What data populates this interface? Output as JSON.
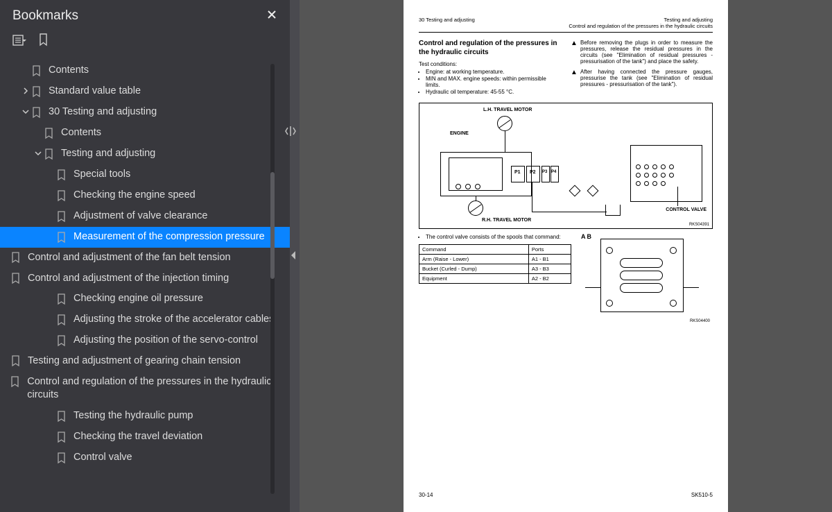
{
  "sidebar": {
    "title": "Bookmarks",
    "tree": [
      {
        "lvl": 1,
        "chev": "",
        "label": "Contents"
      },
      {
        "lvl": 1,
        "chev": ">",
        "label": "Standard value table"
      },
      {
        "lvl": 1,
        "chev": "v",
        "label": "30 Testing and adjusting"
      },
      {
        "lvl": 2,
        "chev": "",
        "label": "Contents"
      },
      {
        "lvl": 2,
        "chev": "v",
        "label": "Testing and adjusting"
      },
      {
        "lvl": 3,
        "chev": "",
        "label": "Special tools"
      },
      {
        "lvl": 3,
        "chev": "",
        "label": "Checking the engine speed"
      },
      {
        "lvl": 3,
        "chev": "",
        "label": "Adjustment of valve clearance"
      },
      {
        "lvl": 3,
        "chev": "",
        "label": "Measurement of the compression pressure",
        "sel": true
      },
      {
        "lvl": 3,
        "chev": "",
        "label": "Control and adjustment of the fan belt tension",
        "tall": true
      },
      {
        "lvl": 3,
        "chev": "",
        "label": "Control and adjustment of the injection timing",
        "tall": true
      },
      {
        "lvl": 3,
        "chev": "",
        "label": "Checking engine oil pressure"
      },
      {
        "lvl": 3,
        "chev": "",
        "label": "Adjusting the stroke of the accelerator cables"
      },
      {
        "lvl": 3,
        "chev": "",
        "label": "Adjusting the position of the servo-control"
      },
      {
        "lvl": 3,
        "chev": "",
        "label": "Testing and adjustment of gearing chain tension",
        "tall": true
      },
      {
        "lvl": 3,
        "chev": "",
        "label": "Control and regulation of the pressures in the hydraulic circuits",
        "tall": true
      },
      {
        "lvl": 3,
        "chev": "",
        "label": "Testing the hydraulic pump"
      },
      {
        "lvl": 3,
        "chev": "",
        "label": "Checking the travel deviation"
      },
      {
        "lvl": 3,
        "chev": "",
        "label": "Control valve"
      }
    ]
  },
  "page": {
    "hdr_l": "30 Testing and adjusting",
    "hdr_r1": "Testing and adjusting",
    "hdr_r2": "Control and regulation of the pressures in the hydraulic circuits",
    "title": "Control and regulation of the pressures in the hydraulic circuits",
    "tc_label": "Test conditions:",
    "tc": [
      "Engine: at working temperature.",
      "MIN and MAX. engine speeds: within permissible limits.",
      "Hydraulic oil temperature: 45-55 °C."
    ],
    "warn1": "Before removing the plugs in order to measure the pressures, release the residual pressures in the circuits (see \"Elimination of residual pressures - pressurisation of the tank\") and place the safety.",
    "warn2": "After having connected the pressure gauges, pressurise the tank (see \"Elimination of residual pressures - pressurisation of the tank\").",
    "diag": {
      "lh": "L.H. TRAVEL MOTOR",
      "rh": "R.H. TRAVEL MOTOR",
      "eng": "ENGINE",
      "cv": "CONTROL VALVE",
      "p1": "P1",
      "p2": "P2",
      "p3": "P3",
      "p4": "P4",
      "ref": "RKS04391"
    },
    "note": "The control valve consists of the spools that command:",
    "table": {
      "h1": "Command",
      "h2": "Ports",
      "rows": [
        {
          "c": "Arm (Raise - Lower)",
          "p": "A1 - B1"
        },
        {
          "c": "Bucket (Curled - Dump)",
          "p": "A3 - B3"
        },
        {
          "c": "Equipment",
          "p": "A2 - B2"
        }
      ]
    },
    "diag2": {
      "a": "A",
      "b": "B",
      "ref": "RKS04400"
    },
    "foot_l": "30-14",
    "foot_r": "SK510-5"
  }
}
